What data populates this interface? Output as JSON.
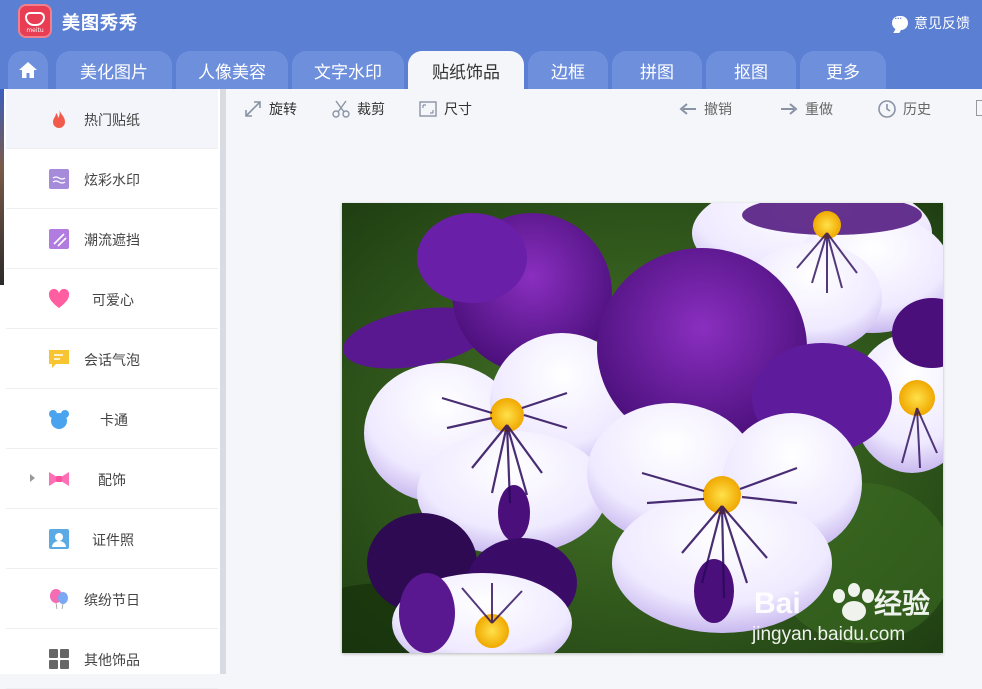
{
  "app": {
    "name": "美图秀秀",
    "logo_text": "meitu",
    "feedback_label": "意见反馈"
  },
  "tabs": [
    {
      "label": "美化图片",
      "active": false
    },
    {
      "label": "人像美容",
      "active": false
    },
    {
      "label": "文字水印",
      "active": false
    },
    {
      "label": "贴纸饰品",
      "active": true
    },
    {
      "label": "边框",
      "active": false
    },
    {
      "label": "拼图",
      "active": false
    },
    {
      "label": "抠图",
      "active": false
    },
    {
      "label": "更多",
      "active": false
    }
  ],
  "sidebar": {
    "items": [
      {
        "label": "热门贴纸",
        "icon": "fire-icon",
        "active": true
      },
      {
        "label": "炫彩水印",
        "icon": "watermark-icon",
        "active": false
      },
      {
        "label": "潮流遮挡",
        "icon": "mosaic-icon",
        "active": false
      },
      {
        "label": "可爱心",
        "icon": "heart-icon",
        "active": false
      },
      {
        "label": "会话气泡",
        "icon": "speech-bubble-icon",
        "active": false
      },
      {
        "label": "卡通",
        "icon": "cartoon-bear-icon",
        "active": false
      },
      {
        "label": "配饰",
        "icon": "bow-icon",
        "active": false
      },
      {
        "label": "证件照",
        "icon": "id-photo-icon",
        "active": false
      },
      {
        "label": "缤纷节日",
        "icon": "balloon-icon",
        "active": false
      },
      {
        "label": "其他饰品",
        "icon": "grid-icon",
        "active": false
      }
    ]
  },
  "toolbar": {
    "rotate": "旋转",
    "crop": "裁剪",
    "size": "尺寸",
    "undo": "撤销",
    "redo": "重做",
    "history": "历史"
  },
  "watermark": {
    "brand": "Bai",
    "brand_suffix": "经验",
    "url": "jingyan.baidu.com"
  },
  "colors": {
    "header": "#5b7fd3",
    "tab": "#6e8fdc",
    "accent_red": "#e83d52"
  }
}
